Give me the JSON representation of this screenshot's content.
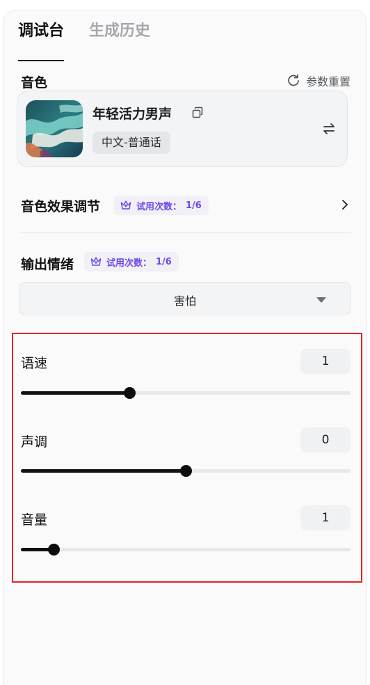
{
  "tabs": [
    {
      "label": "调试台",
      "active": true
    },
    {
      "label": "生成历史",
      "active": false
    }
  ],
  "voice_section": {
    "title": "音色",
    "reset_label": "参数重置"
  },
  "voice_card": {
    "name": "年轻活力男声",
    "language": "中文-普通话",
    "icons": [
      "copy-icon",
      "swap-icon"
    ]
  },
  "voice_effect": {
    "title": "音色效果调节",
    "trial_label": "试用次数：",
    "trial_count": "1/6"
  },
  "emotion": {
    "title": "输出情绪",
    "trial_label": "试用次数：",
    "trial_count": "1/6",
    "selected": "害怕"
  },
  "sliders": [
    {
      "label": "语速",
      "value": "1",
      "position": 0.33
    },
    {
      "label": "声调",
      "value": "0",
      "position": 0.5
    },
    {
      "label": "音量",
      "value": "1",
      "position": 0.1
    }
  ],
  "colors": {
    "accent": "#6f47e8",
    "highlight_border": "#e0232b"
  }
}
